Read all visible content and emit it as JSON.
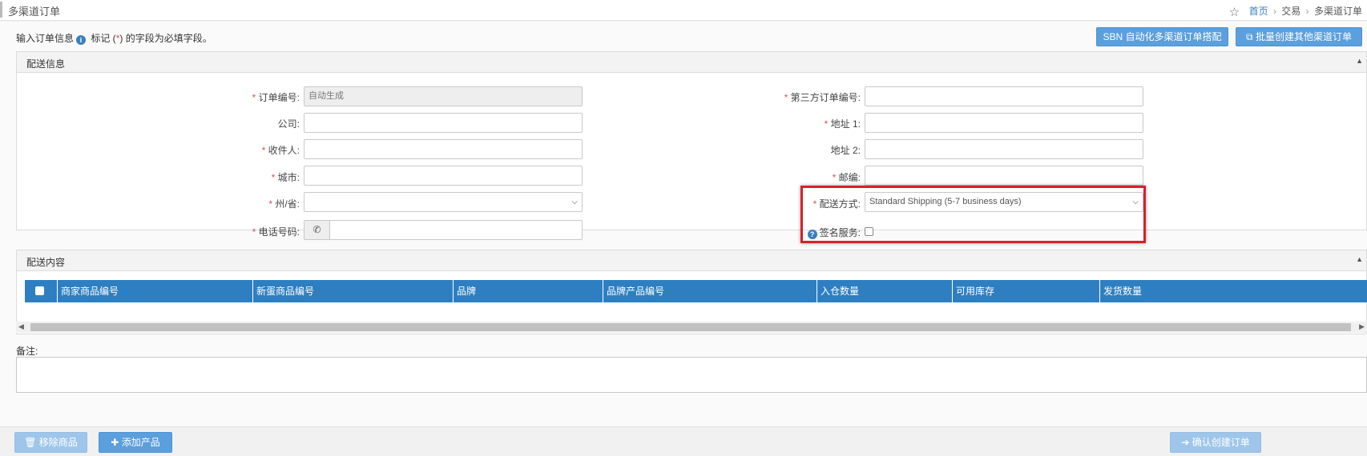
{
  "header": {
    "page_title": "多渠道订单",
    "breadcrumb": {
      "home": "首页",
      "trade": "交易",
      "current": "多渠道订单",
      "sep": "›"
    }
  },
  "intro": {
    "text_before": "输入订单信息",
    "text_middle": " 标记 (",
    "required_mark": "*",
    "text_after": ") 的字段为必填字段。"
  },
  "actions": {
    "sbn_button": "SBN 自动化多渠道订单搭配",
    "batch_button": "批量创建其他渠道订单"
  },
  "shipping_panel": {
    "title": "配送信息",
    "fields": {
      "order_no": {
        "label": "订单编号:",
        "placeholder": "自动生成"
      },
      "third_party_no": {
        "label": "第三方订单编号:"
      },
      "company": {
        "label": "公司:"
      },
      "address1": {
        "label": "地址 1:"
      },
      "recipient": {
        "label": "收件人:"
      },
      "address2": {
        "label": "地址 2:"
      },
      "city": {
        "label": "城市:"
      },
      "zip": {
        "label": "邮编:"
      },
      "state": {
        "label": "州/省:",
        "value": ""
      },
      "shipping_method": {
        "label": "配送方式:",
        "value": "Standard Shipping (5-7 business days)"
      },
      "phone": {
        "label": "电话号码:"
      },
      "signature": {
        "label": "签名服务:",
        "checked": false
      }
    }
  },
  "items_panel": {
    "title": "配送内容",
    "columns": [
      "商家商品编号",
      "新蛋商品编号",
      "品牌",
      "品牌产品编号",
      "入仓数量",
      "可用库存",
      "发货数量"
    ]
  },
  "remark": {
    "label": "备注:"
  },
  "footer": {
    "remove_button": "移除商品",
    "add_button": "添加产品",
    "confirm_button": "确认创建订单"
  },
  "colors": {
    "primary": "#5b9fdd",
    "table_header": "#2e7fc1",
    "highlight": "#d9202a",
    "required": "#d9534f"
  }
}
